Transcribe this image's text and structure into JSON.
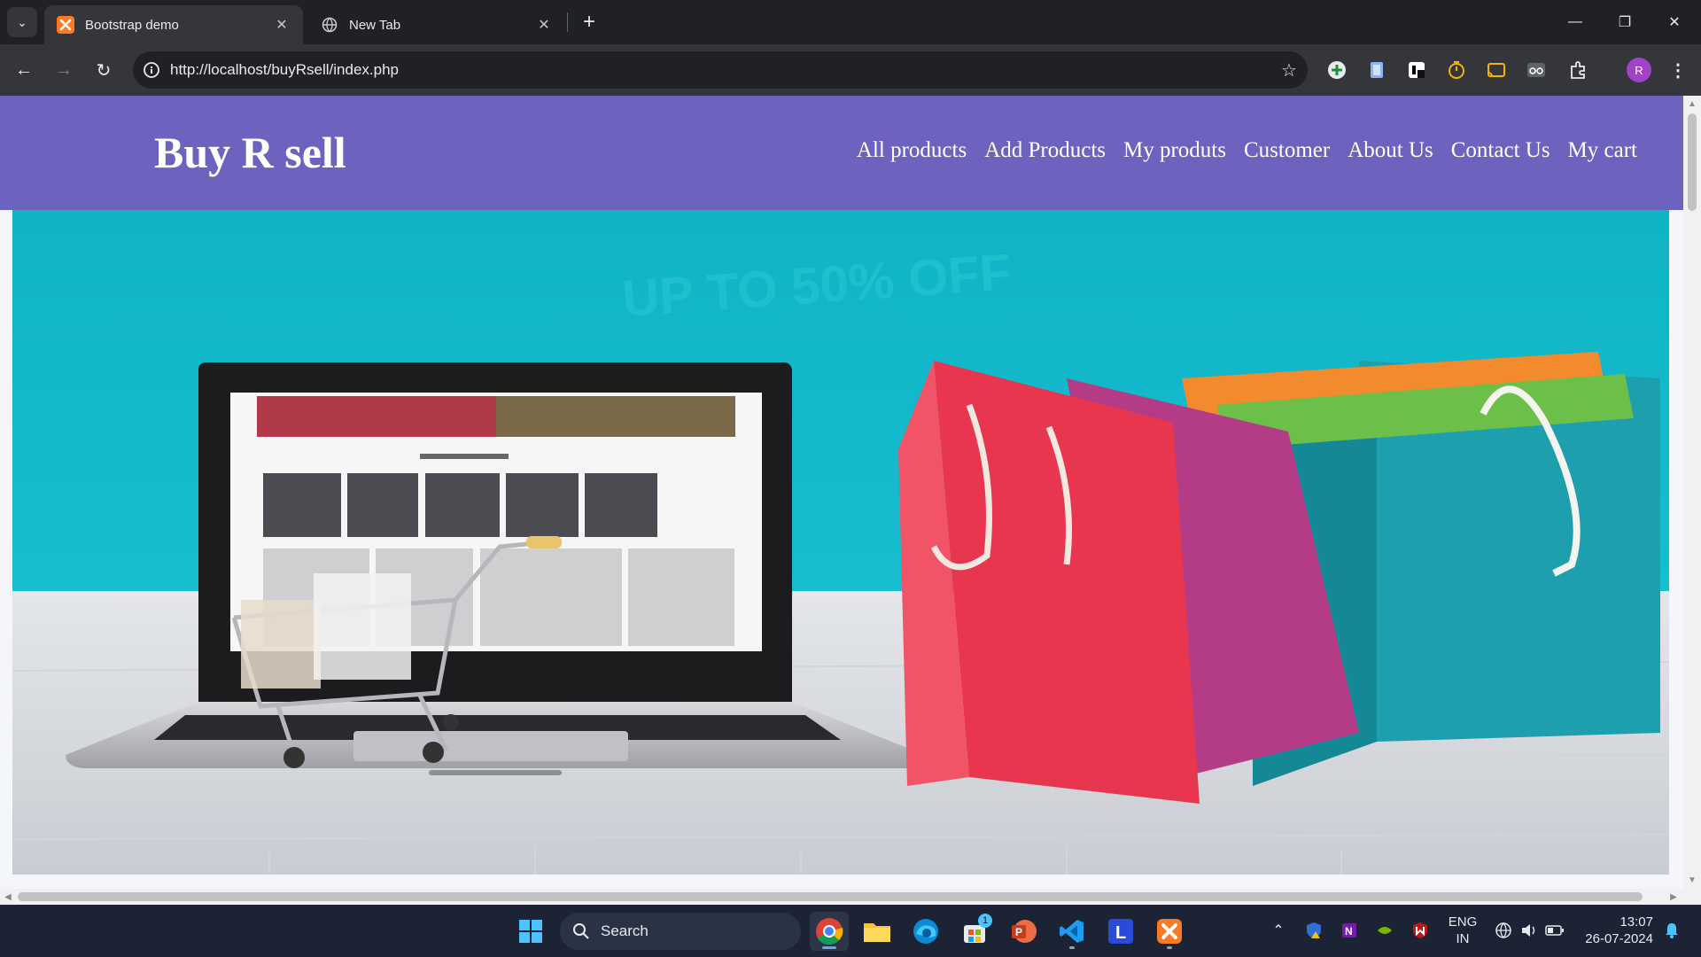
{
  "browser": {
    "tabs": [
      {
        "title": "Bootstrap demo",
        "active": true
      },
      {
        "title": "New Tab",
        "active": false
      }
    ],
    "address": "http://localhost/buyRsell/index.php"
  },
  "site": {
    "brand": "Buy R sell",
    "nav": [
      "All products",
      "Add Products",
      "My produts",
      "Customer",
      "About Us",
      "Contact Us",
      "My cart"
    ],
    "hero_banner_text": "UP TO 50% OFF"
  },
  "taskbar": {
    "search_placeholder": "Search",
    "language_line1": "ENG",
    "language_line2": "IN",
    "time": "13:07",
    "date": "26-07-2024",
    "store_badge": "1"
  },
  "profile": {
    "initial": "R"
  },
  "colors": {
    "navbar": "#6c63bf",
    "hero_sky": "#13b9c8",
    "browser_dark": "#202124",
    "taskbar": "#1b2335"
  }
}
